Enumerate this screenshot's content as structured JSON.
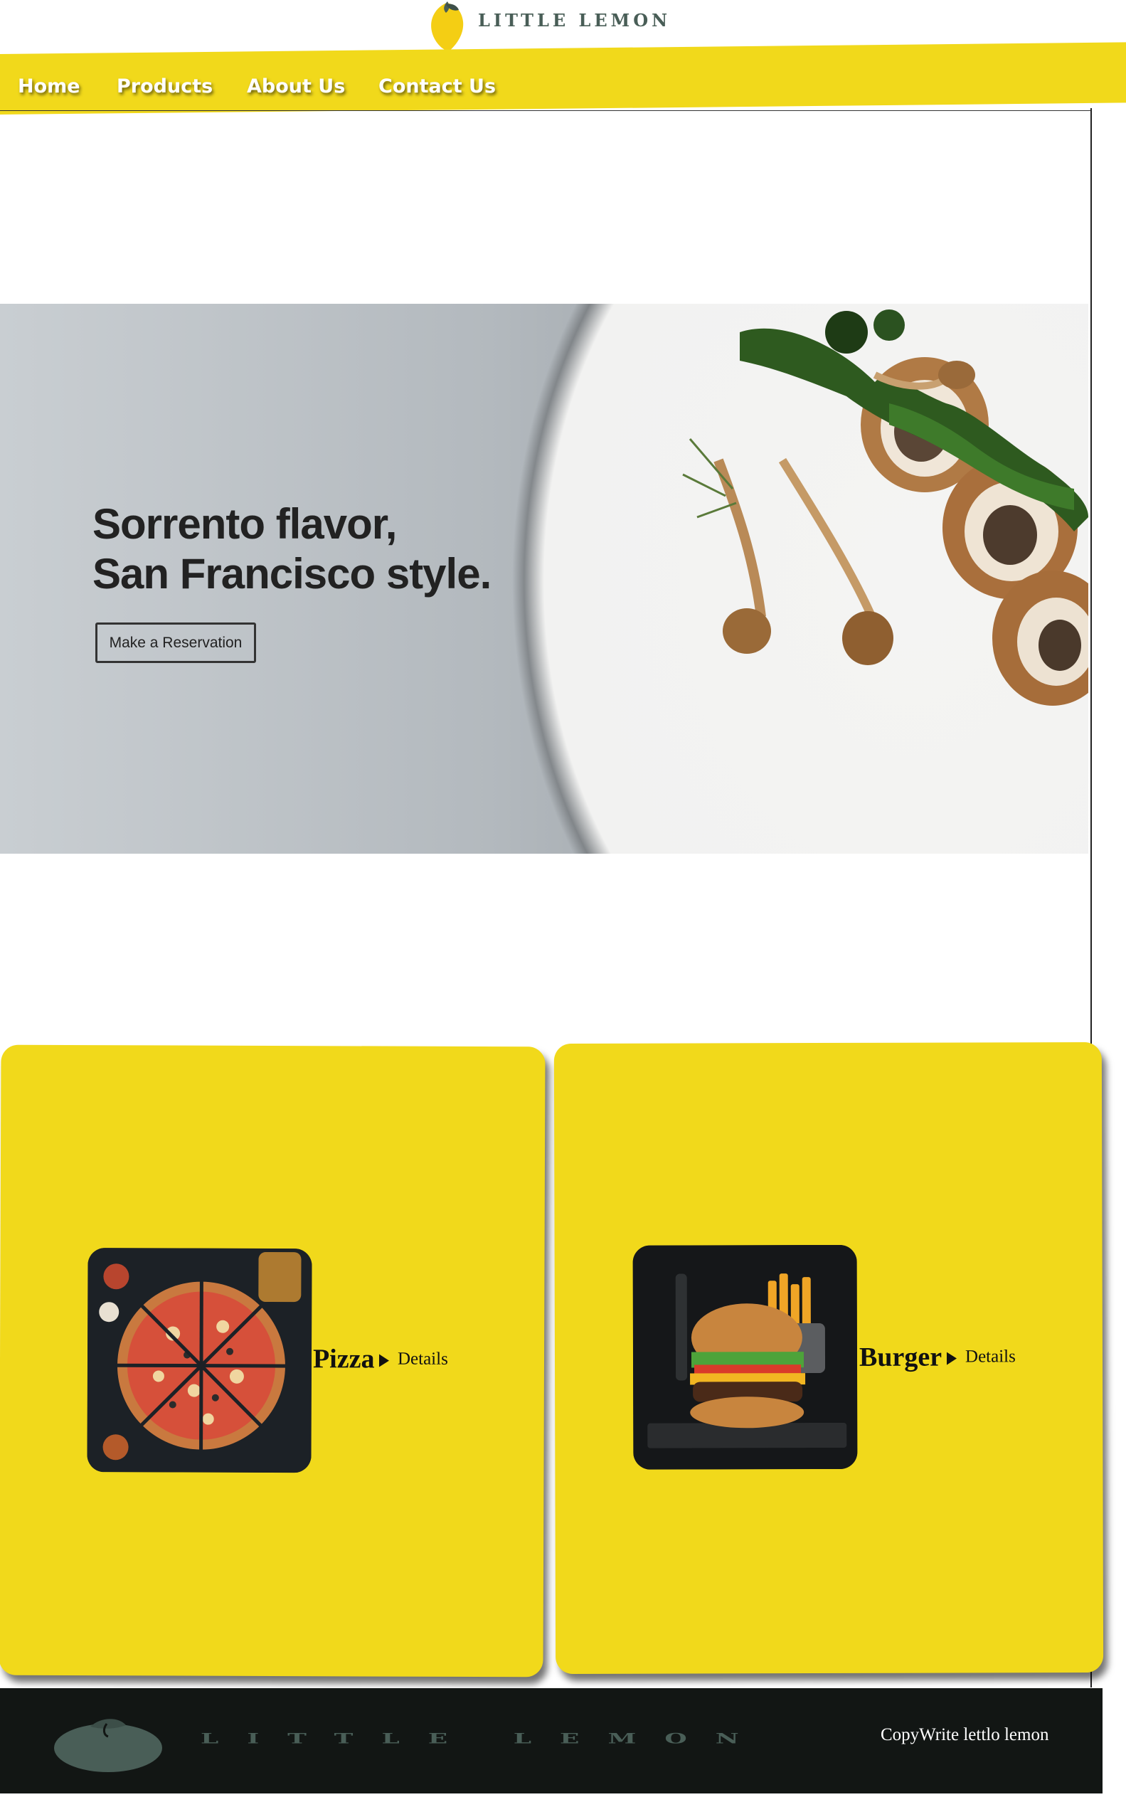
{
  "header": {
    "logo_text": "LITTLE LEMON",
    "logo_icon": "lemon-icon"
  },
  "nav": {
    "items": [
      {
        "label": "Home"
      },
      {
        "label": "Products"
      },
      {
        "label": "About Us"
      },
      {
        "label": "Contact Us"
      }
    ]
  },
  "hero": {
    "headline_line1": "Sorrento flavor,",
    "headline_line2": "San Francisco style.",
    "cta_label": "Make a Reservation"
  },
  "products": [
    {
      "title": "Pizza",
      "details_label": "Details",
      "image": "pizza-image"
    },
    {
      "title": "Burger",
      "details_label": "Details",
      "image": "burger-image"
    }
  ],
  "footer": {
    "logo_text": "LITTLE LEMON",
    "copyright": "CopyWrite lettlo lemon"
  },
  "colors": {
    "brand_yellow": "#f1d91b",
    "brand_green": "#495e57",
    "footer_bg": "#121614"
  }
}
